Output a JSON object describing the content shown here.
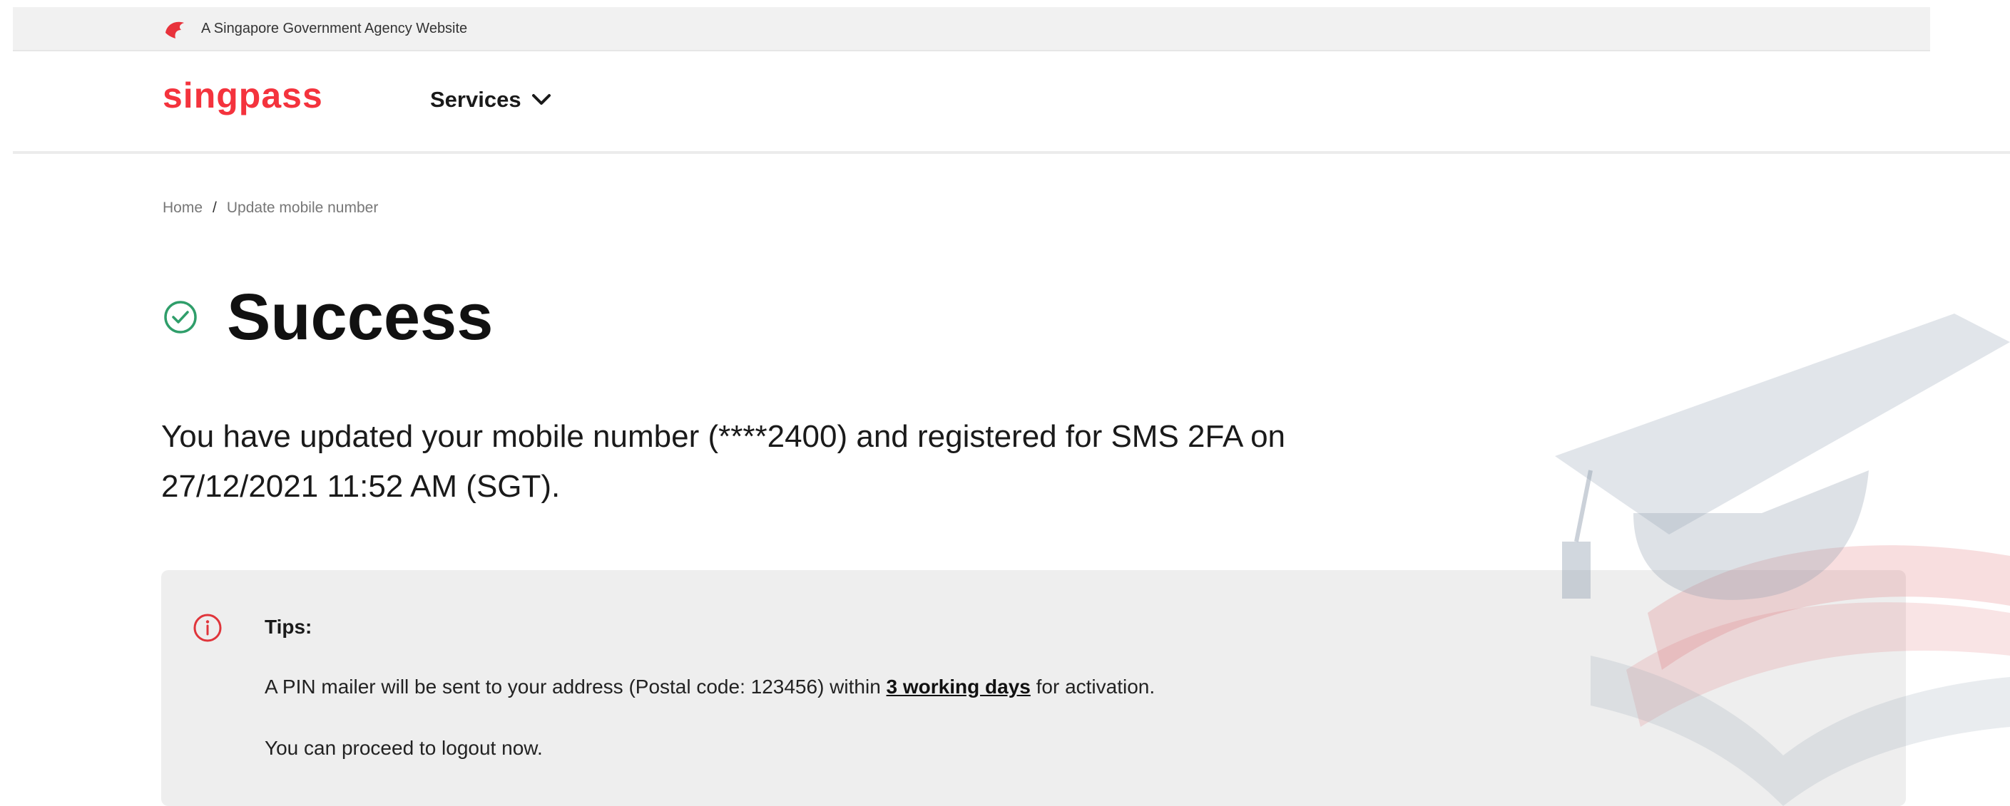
{
  "gov_banner": {
    "text": "A Singapore Government Agency Website"
  },
  "nav": {
    "brand": "singpass",
    "services_label": "Services",
    "brand_color": "#f4333d"
  },
  "breadcrumb": {
    "home": "Home",
    "separator": "/",
    "current": "Update mobile number"
  },
  "main": {
    "title": "Success",
    "message": "You have updated your mobile number (****2400) and registered for SMS 2FA on 27/12/2021 11:52 AM (SGT).",
    "success_color": "#2f9e6a"
  },
  "tips": {
    "title": "Tips:",
    "line1_prefix": "A PIN mailer will be sent to your address (Postal code: 123456) within ",
    "line1_emphasis": "3 working days",
    "line1_suffix": " for activation.",
    "line2": "You can proceed to logout now.",
    "icon_color": "#e0353b"
  },
  "icons": [
    "singapore-lion-icon",
    "chevron-down-icon",
    "check-circle-icon",
    "info-icon",
    "graduation-cap-watermark"
  ]
}
